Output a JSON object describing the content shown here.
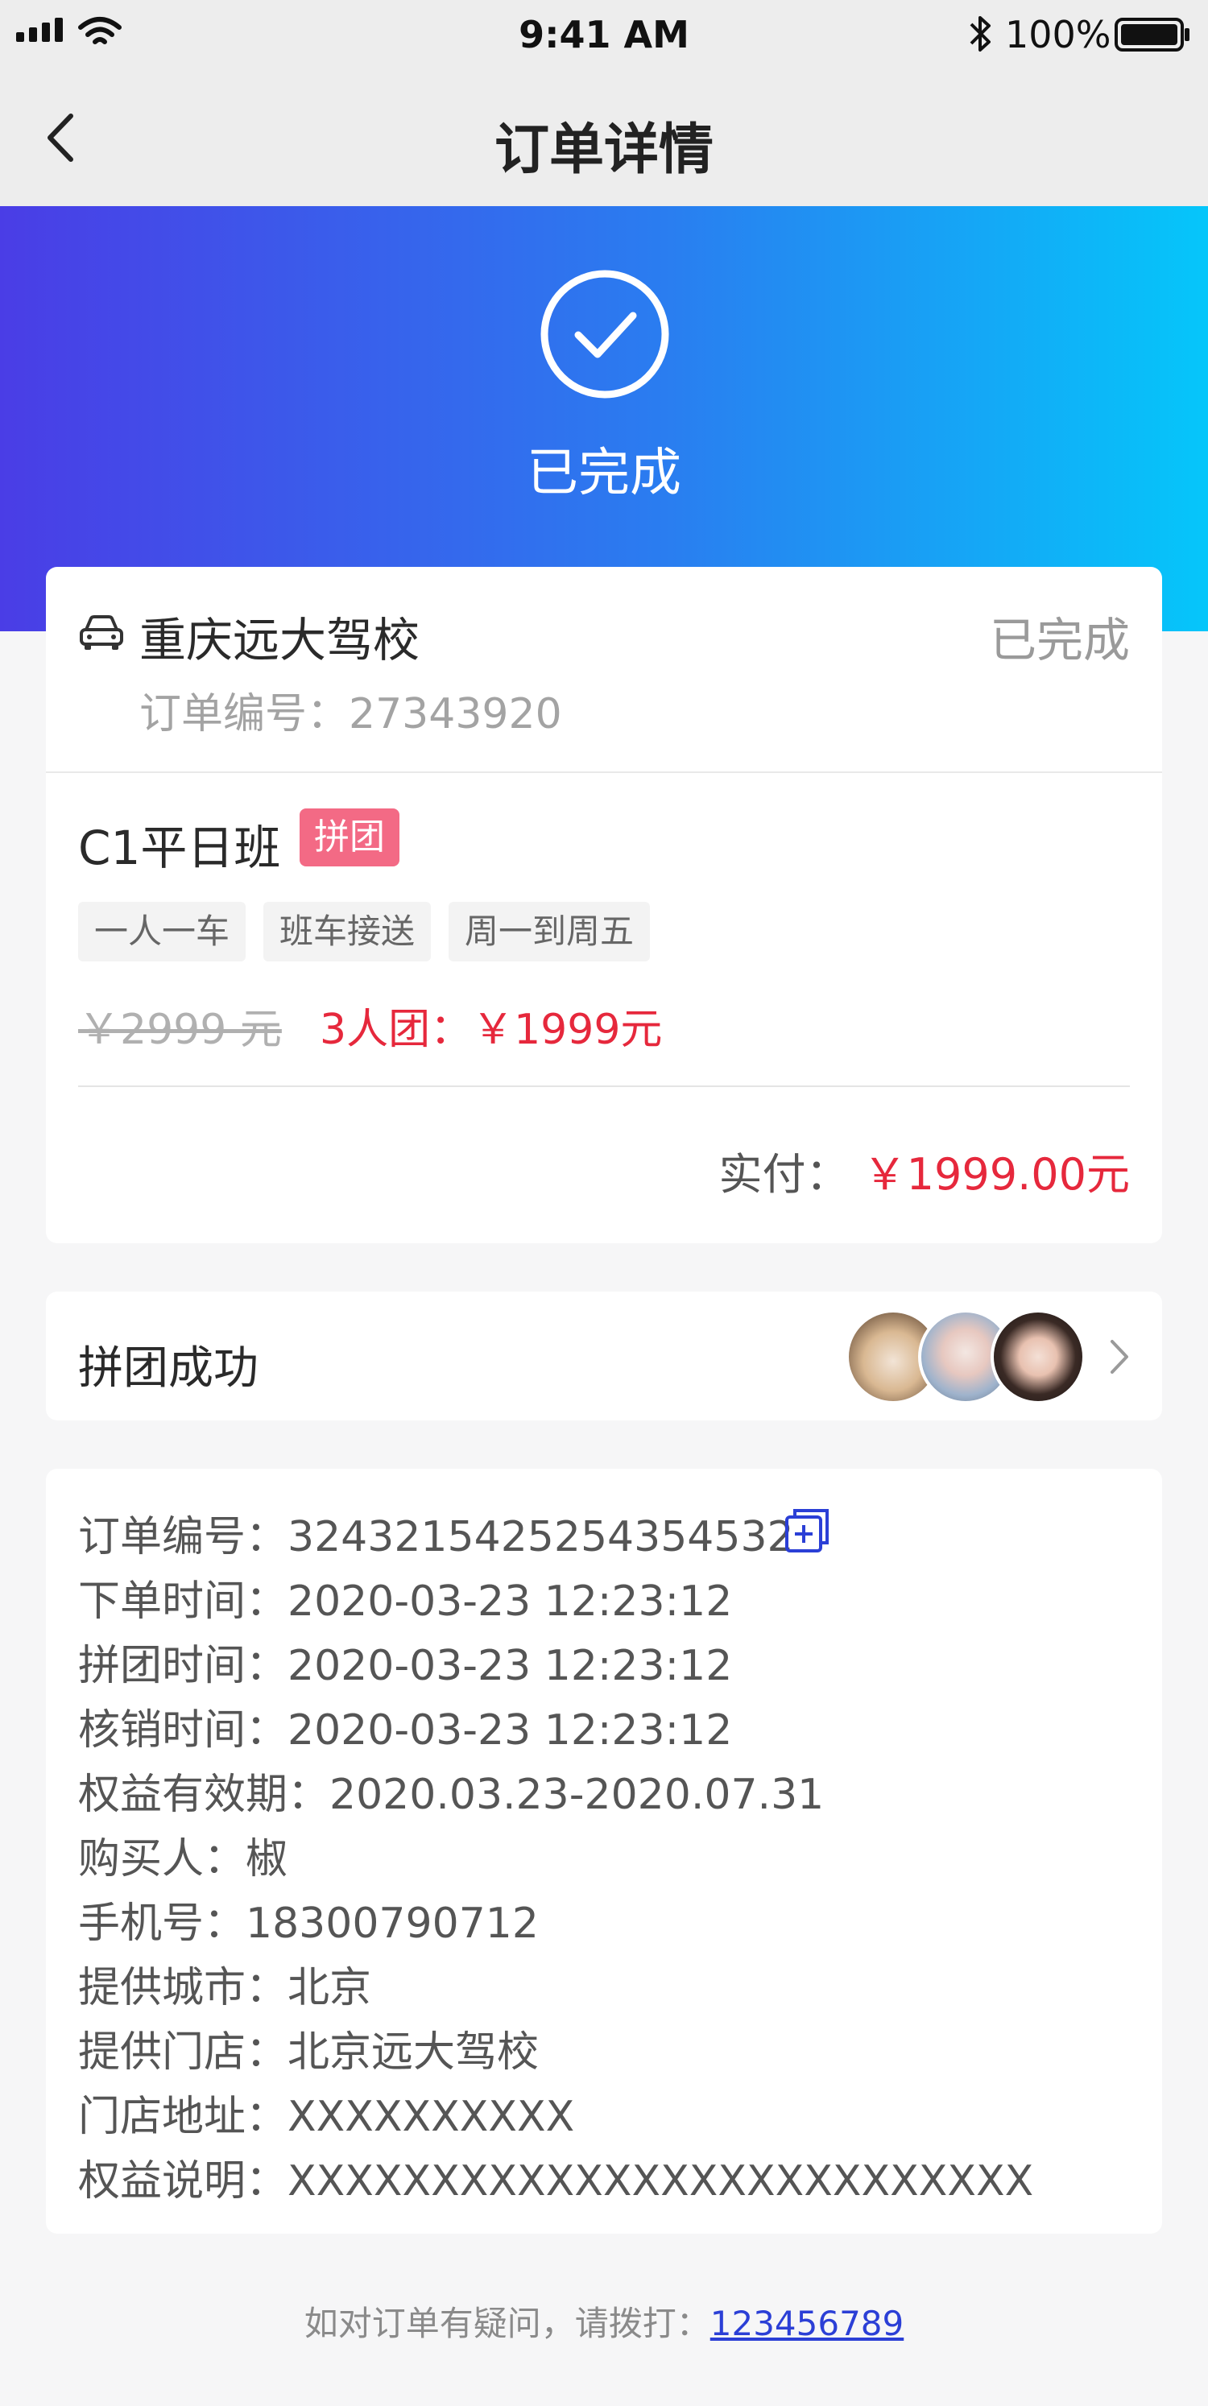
{
  "status_bar": {
    "time": "9:41 AM",
    "battery": "100%"
  },
  "nav": {
    "title": "订单详情"
  },
  "hero": {
    "status": "已完成"
  },
  "order": {
    "school": "重庆远大驾校",
    "state": "已完成",
    "order_no_label": "订单编号：",
    "order_no": "27343920",
    "course": "C1平日班",
    "tag": "拼团",
    "features": [
      "一人一车",
      "班车接送",
      "周一到周五"
    ],
    "original_price": "￥2999 元",
    "group_price": "3人团：￥1999元",
    "paid_label": "实付：",
    "paid_value": "￥1999.00元"
  },
  "group": {
    "label": "拼团成功",
    "avatars": [
      "cat-avatar",
      "girl-avatar-1",
      "girl-avatar-2"
    ]
  },
  "details": {
    "rows": [
      {
        "label": "订单编号：",
        "value": "3243215425254354532"
      },
      {
        "label": "下单时间：",
        "value": "2020-03-23 12:23:12"
      },
      {
        "label": "拼团时间：",
        "value": "2020-03-23 12:23:12"
      },
      {
        "label": "核销时间：",
        "value": "2020-03-23 12:23:12"
      },
      {
        "label": "权益有效期：",
        "value": "2020.03.23-2020.07.31"
      },
      {
        "label": "购买人：",
        "value": "椒"
      },
      {
        "label": "手机号：",
        "value": "18300790712"
      },
      {
        "label": "提供城市：",
        "value": "北京"
      },
      {
        "label": "提供门店：",
        "value": "北京远大驾校"
      },
      {
        "label": "门店地址：",
        "value": "XXXXXXXXXX"
      },
      {
        "label": "权益说明：",
        "value": "XXXXXXXXXXXXXXXXXXXXXXXXXX"
      }
    ]
  },
  "footer": {
    "text": "如对订单有疑问，请拨打：",
    "phone": "123456789"
  },
  "colors": {
    "accent_red": "#e6283c",
    "tag_pink": "#f36a85",
    "link_blue": "#2b3fd6",
    "gradient_start": "#4a3de6",
    "gradient_end": "#05c6fa"
  }
}
